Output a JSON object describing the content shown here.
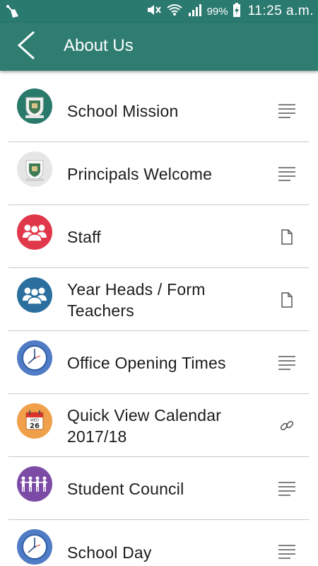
{
  "status_bar": {
    "battery_percent": "99%",
    "time": "11:25 a.m."
  },
  "header": {
    "title": "About Us"
  },
  "items": [
    {
      "label": "School Mission",
      "icon": "school-crest-icon",
      "action_icon": "text-lines-icon"
    },
    {
      "label": "Principals Welcome",
      "icon": "school-crest-icon",
      "action_icon": "text-lines-icon"
    },
    {
      "label": "Staff",
      "icon": "group-people-icon",
      "action_icon": "document-icon"
    },
    {
      "label": "Year Heads / Form Teachers",
      "icon": "group-people-icon",
      "action_icon": "document-icon"
    },
    {
      "label": "Office Opening Times",
      "icon": "clock-icon",
      "action_icon": "text-lines-icon"
    },
    {
      "label": "Quick View Calendar 2017/18",
      "icon": "calendar-icon",
      "action_icon": "link-icon",
      "calendar_day": "WED",
      "calendar_date": "26"
    },
    {
      "label": "Student Council",
      "icon": "people-chain-icon",
      "action_icon": "text-lines-icon"
    },
    {
      "label": "School Day",
      "icon": "clock-icon",
      "action_icon": "text-lines-icon"
    }
  ],
  "colors": {
    "status_bar": "#2b7a6f",
    "app_bar": "#2e7d70",
    "crest_teal": "#2a7a6b",
    "crest_grey": "#e6e6e6",
    "staff_red": "#e0384a",
    "year_heads_blue": "#2a6f9e",
    "clock_blue": "#4f7cc4",
    "calendar_orange": "#f0a04a",
    "council_purple": "#7b4ba6"
  }
}
